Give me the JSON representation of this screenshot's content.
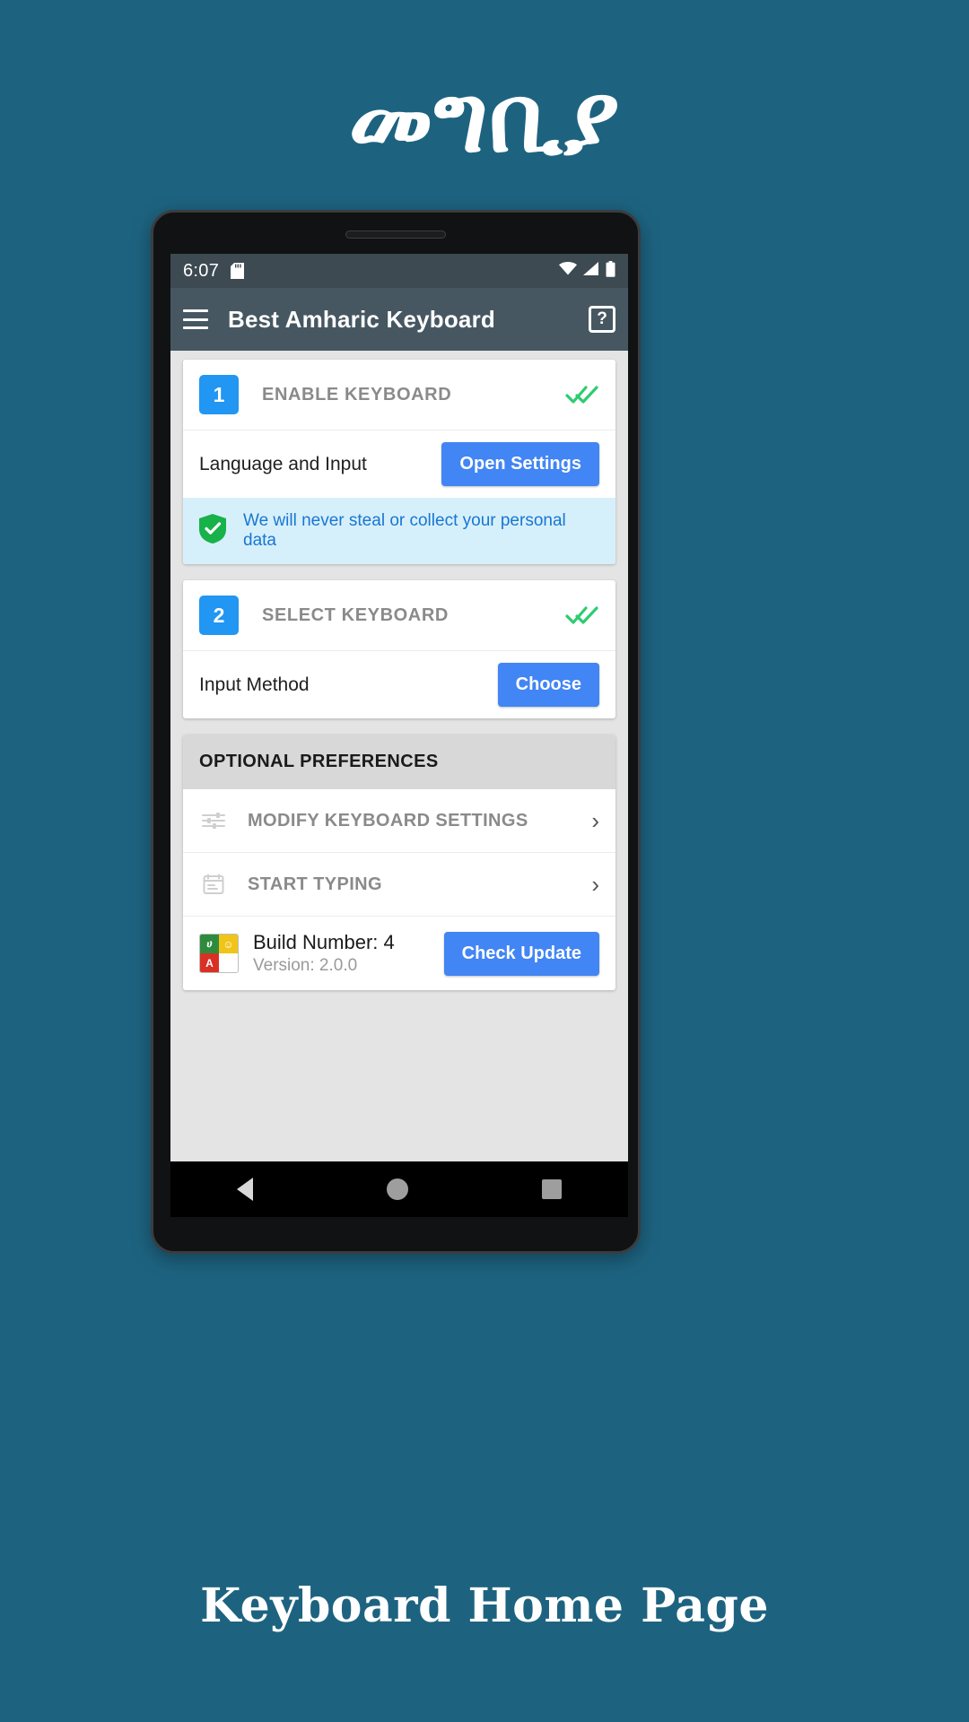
{
  "poster": {
    "headline_amharic": "መግቢያ",
    "caption": "Keyboard Home Page",
    "background_color": "#1d6380"
  },
  "statusbar": {
    "time": "6:07",
    "sd_icon": "sd-card-icon",
    "wifi_icon": "wifi-icon",
    "signal_icon": "cellular-signal-icon",
    "battery_icon": "battery-icon"
  },
  "appbar": {
    "menu_icon": "hamburger-menu-icon",
    "title": "Best Amharic Keyboard",
    "help_label": "?",
    "background_color": "#465761"
  },
  "steps": [
    {
      "number": "1",
      "title": "ENABLE KEYBOARD",
      "check_icon": "double-check-icon",
      "row_label": "Language and Input",
      "button_label": "Open Settings"
    },
    {
      "number": "2",
      "title": "SELECT KEYBOARD",
      "check_icon": "double-check-icon",
      "row_label": "Input Method",
      "button_label": "Choose"
    }
  ],
  "privacy": {
    "icon": "green-shield-check-icon",
    "text": "We will never steal or collect your personal data",
    "text_color": "#1976d2",
    "background_color": "#d6f0fb"
  },
  "preferences": {
    "header": "OPTIONAL PREFERENCES",
    "items": [
      {
        "icon": "sliders-settings-icon",
        "label": "MODIFY KEYBOARD SETTINGS",
        "chevron": "›"
      },
      {
        "icon": "note-typing-icon",
        "label": "START TYPING",
        "chevron": "›"
      }
    ],
    "build": {
      "app_icon": "amharic-keyboard-app-icon",
      "build_label": "Build Number: 4",
      "version_label": "Version: 2.0.0",
      "update_button": "Check Update"
    }
  },
  "navbar": {
    "back_icon": "back-triangle-icon",
    "home_icon": "home-circle-icon",
    "recents_icon": "recents-square-icon"
  },
  "colors": {
    "accent_blue": "#2196f3",
    "button_blue": "#4285f4",
    "check_green": "#2ecc71",
    "shield_green": "#17b24a"
  }
}
